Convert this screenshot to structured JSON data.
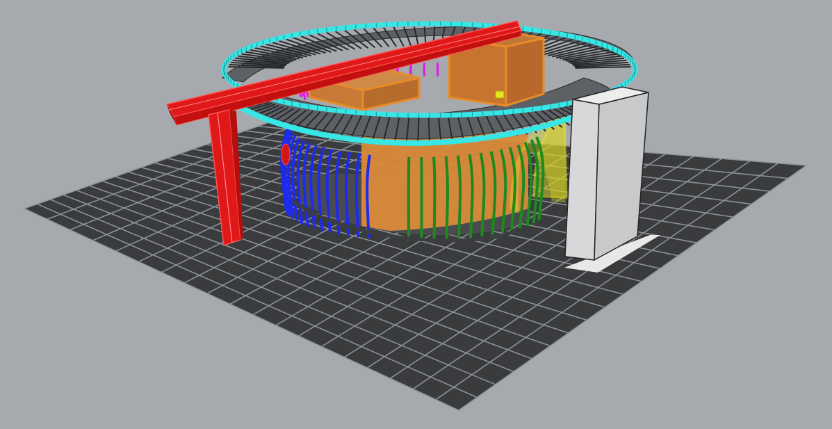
{
  "viewport": {
    "name": "Perspective",
    "background_color": "#a6a9ae",
    "grid": {
      "visible": true,
      "cell_color": "#3a3b3d",
      "line_color": "#8e9196",
      "rows": 19,
      "cols": 19
    }
  },
  "objects": [
    {
      "name": "steel-i-beam",
      "color": "#ee1c1c",
      "count": 2
    },
    {
      "name": "conveyor-outer-rail",
      "color": "#39e6e6",
      "count": 1
    },
    {
      "name": "conveyor-rollers",
      "color": "#606468",
      "count": 1
    },
    {
      "name": "cardboard-box",
      "color": "#e07d2a",
      "count": 2
    },
    {
      "name": "curved-fins-blue",
      "color": "#1d2bf0",
      "count": 1
    },
    {
      "name": "curved-fins-green",
      "color": "#1c8a1c",
      "count": 1
    },
    {
      "name": "curved-fins-magenta",
      "color": "#e020e0",
      "count": 1
    },
    {
      "name": "yellow-arch-panel",
      "color": "#e6e61a",
      "count": 1
    },
    {
      "name": "gray-pillar",
      "color": "#d7d8d9",
      "count": 1
    }
  ]
}
